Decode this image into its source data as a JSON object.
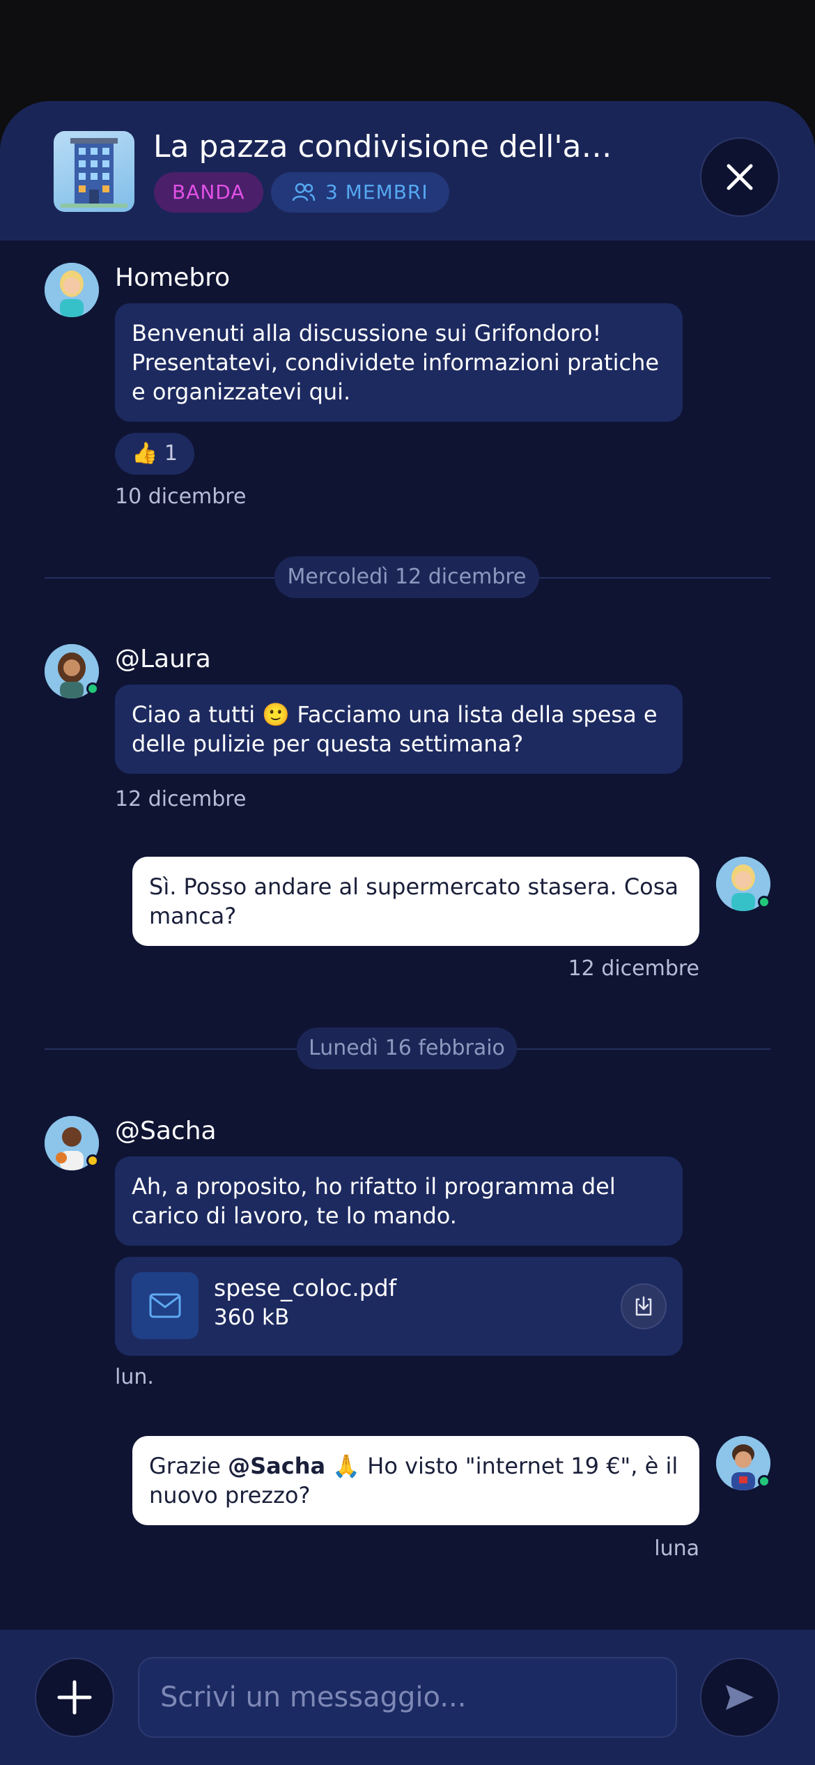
{
  "header": {
    "title": "La pazza condivisione dell'app...",
    "badge_type": "BANDA",
    "members_label": "3 MEMBRI",
    "close_icon": "close-icon"
  },
  "messages": [
    {
      "sender": "Homebro",
      "text": "Benvenuti alla discussione sui Grifondoro! Presentatevi, condividete informazioni pratiche e organizzatevi qui.",
      "reaction_emoji": "👍",
      "reaction_count": "1",
      "time": "10 dicembre"
    },
    {
      "sender": "@Laura",
      "text": "Ciao a tutti 🙂 Facciamo una lista della spesa e delle pulizie per questa settimana?",
      "time": "12 dicembre"
    },
    {
      "text": "Sì. Posso andare al supermercato stasera. Cosa manca?",
      "time": "12 dicembre"
    },
    {
      "sender": "@Sacha",
      "text": "Ah, a proposito, ho rifatto il programma del carico di lavoro, te lo mando.",
      "file_name": "spese_coloc.pdf",
      "file_size": "360 kB",
      "time": "lun."
    },
    {
      "text_prefix": "Grazie ",
      "mention": "@Sacha",
      "text_suffix": " 🙏 Ho visto \"internet 19 €\", è il nuovo prezzo?",
      "time": "luna"
    }
  ],
  "dividers": [
    "Mercoledì 12 dicembre",
    "Lunedì 16 febbraio"
  ],
  "composer": {
    "placeholder": "Scrivi un messaggio..."
  },
  "colors": {
    "background": "#0f1433",
    "header": "#1a2557",
    "bubble_in": "#1d2a60",
    "bubble_out": "#ffffff",
    "badge_banda": "#e052e6",
    "badge_members": "#56a8f2",
    "online": "#22c77a",
    "away": "#f3c21b"
  }
}
